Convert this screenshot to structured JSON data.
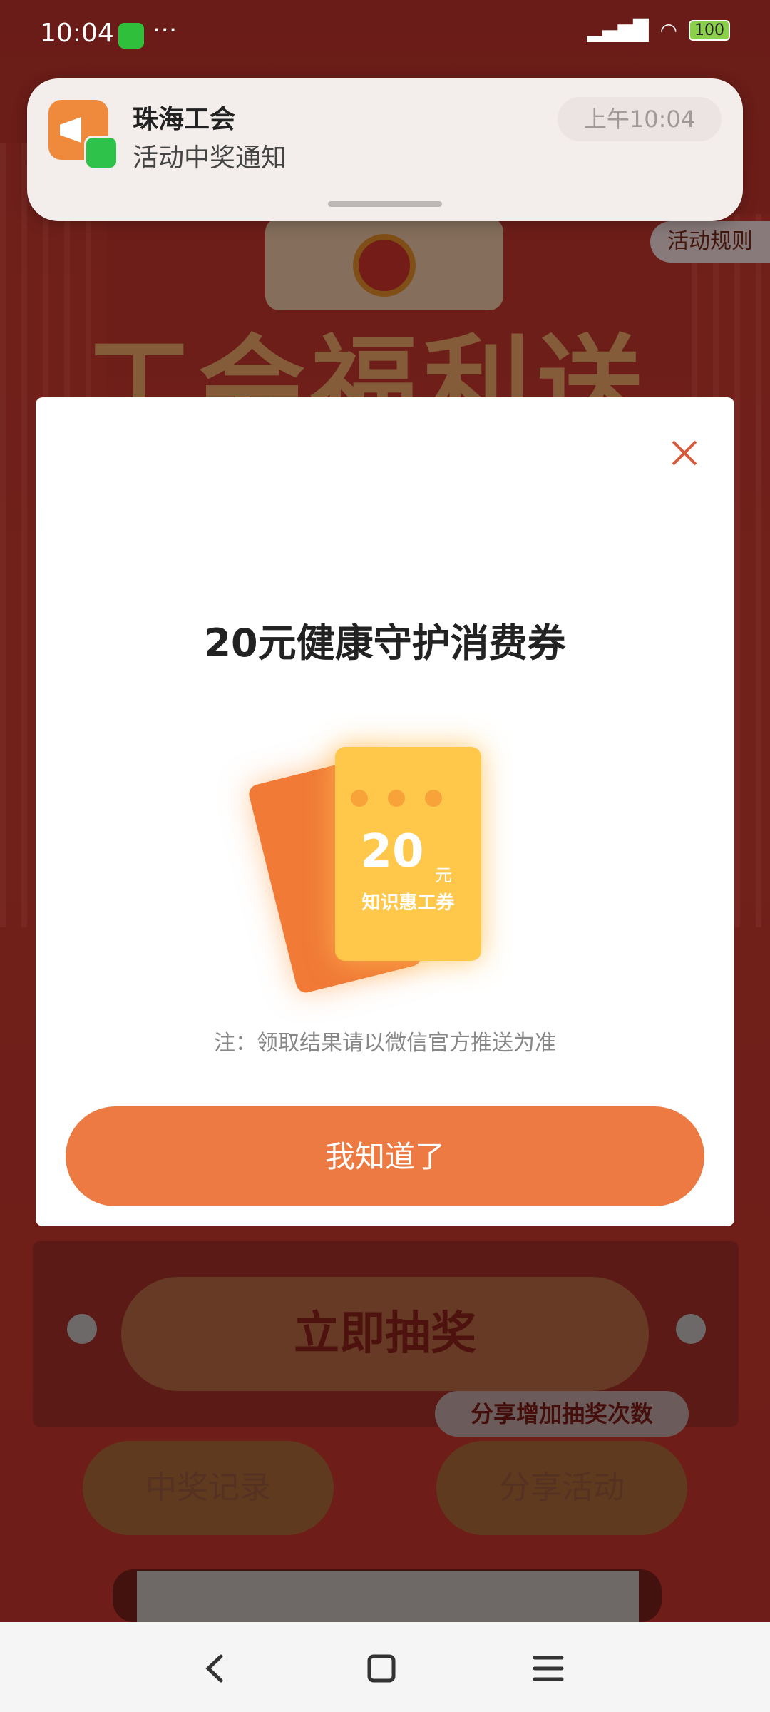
{
  "status_bar": {
    "time": "10:04",
    "more": "···",
    "battery": "100"
  },
  "notification": {
    "app": "珠海工会",
    "message": "活动中奖通知",
    "time": "上午10:04"
  },
  "background": {
    "rules": "活动规则",
    "banner_text": "工会福利送",
    "draw_button": "立即抽奖",
    "share_tip": "分享增加抽奖次数",
    "record_button": "中奖记录",
    "share_button": "分享活动"
  },
  "modal": {
    "title": "20元健康守护消费券",
    "ticket_amount": "20",
    "ticket_unit": "元",
    "ticket_label": "知识惠工券",
    "note": "注：领取结果请以微信官方推送为准",
    "confirm": "我知道了"
  },
  "colors": {
    "accent": "#ec7a42",
    "page_red": "#cf3b30"
  },
  "icons": [
    "close-icon",
    "back-icon",
    "home-icon",
    "menu-icon",
    "megaphone-icon",
    "wechat-icon"
  ]
}
